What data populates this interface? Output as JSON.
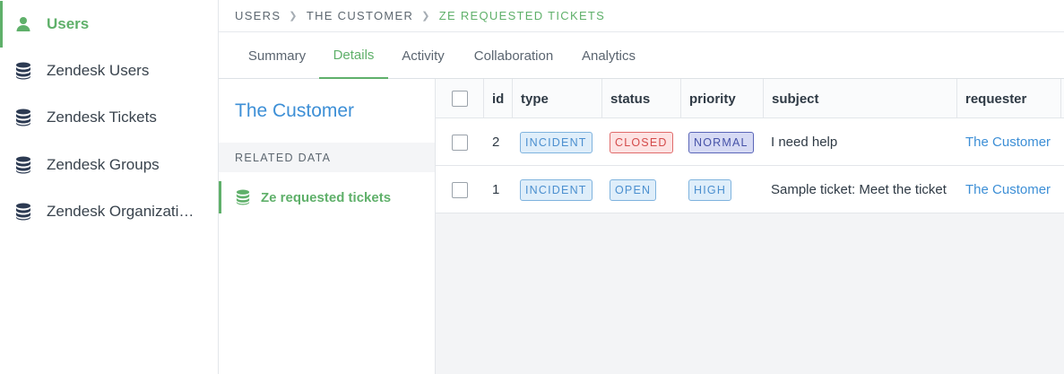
{
  "sidebar": {
    "items": [
      {
        "label": "Users",
        "icon": "user-icon",
        "active": true
      },
      {
        "label": "Zendesk Users",
        "icon": "database-icon"
      },
      {
        "label": "Zendesk Tickets",
        "icon": "database-icon"
      },
      {
        "label": "Zendesk Groups",
        "icon": "database-icon"
      },
      {
        "label": "Zendesk Organizati…",
        "icon": "database-icon"
      }
    ]
  },
  "breadcrumb": {
    "items": [
      "USERS",
      "THE CUSTOMER",
      "ZE REQUESTED TICKETS"
    ]
  },
  "tabs": [
    "Summary",
    "Details",
    "Activity",
    "Collaboration",
    "Analytics"
  ],
  "active_tab": "Details",
  "record": {
    "title": "The Customer",
    "related_heading": "RELATED DATA",
    "related_item": "Ze requested tickets"
  },
  "table": {
    "columns": [
      "id",
      "type",
      "status",
      "priority",
      "subject",
      "requester"
    ],
    "rows": [
      {
        "id": "2",
        "type": "INCIDENT",
        "status": "CLOSED",
        "priority": "NORMAL",
        "subject": "I need help",
        "requester": "The Customer"
      },
      {
        "id": "1",
        "type": "INCIDENT",
        "status": "OPEN",
        "priority": "HIGH",
        "subject": "Sample ticket: Meet the ticket",
        "requester": "The Customer"
      }
    ]
  },
  "colors": {
    "accent_green": "#5fb06a",
    "link_blue": "#3d8fd6",
    "closed_red": "#d44b4b",
    "normal_indigo": "#4652a8"
  }
}
